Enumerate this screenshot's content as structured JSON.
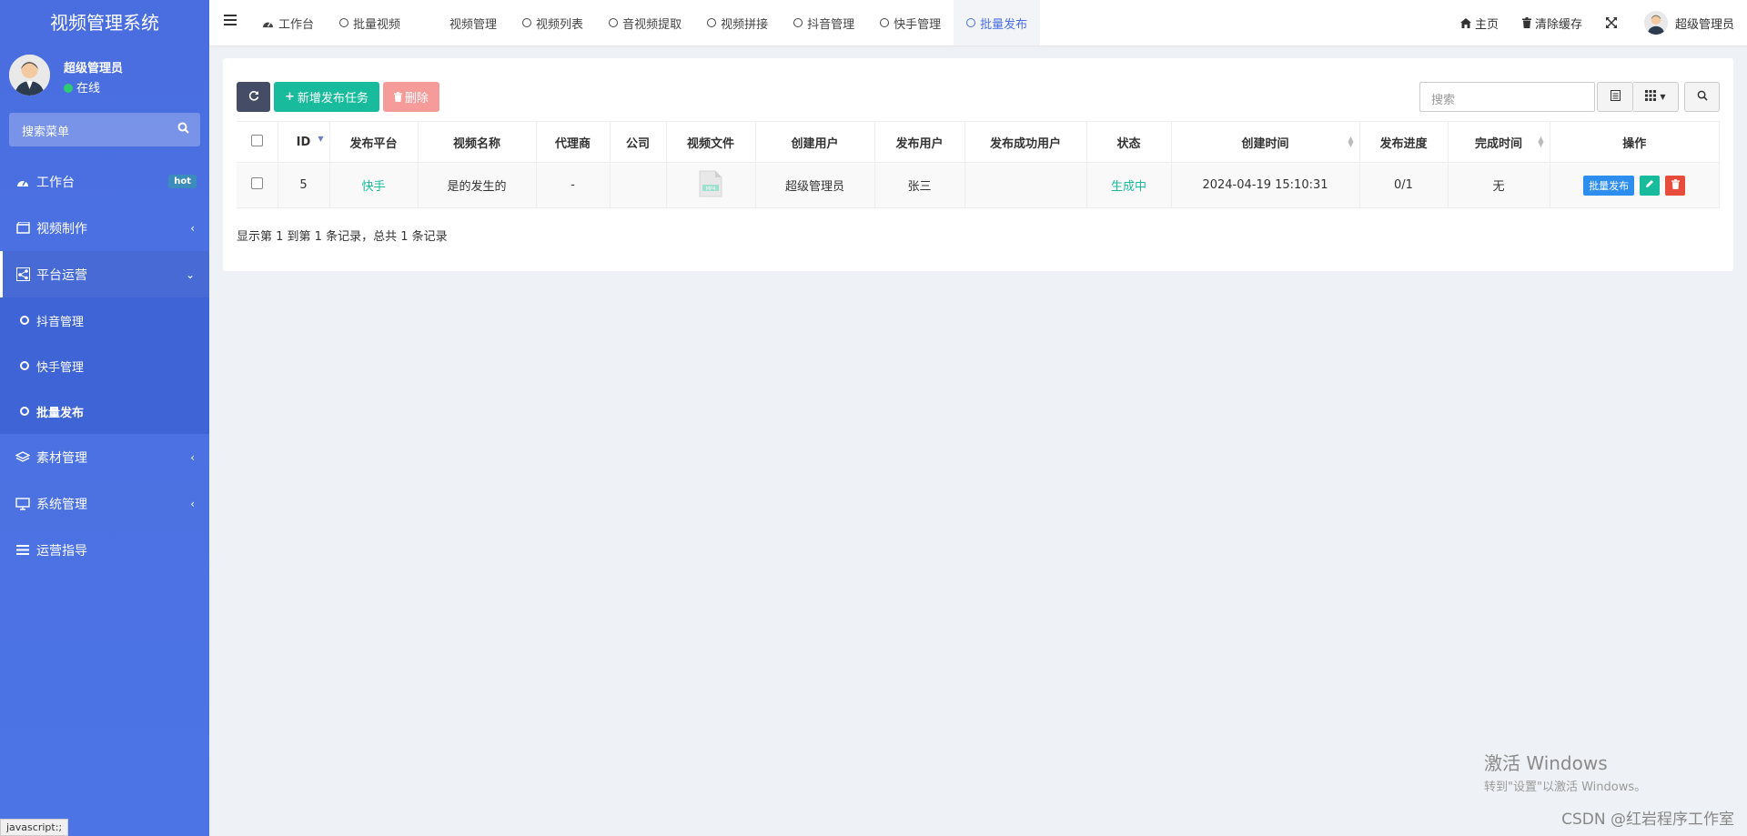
{
  "app": {
    "title": "视频管理系统"
  },
  "user": {
    "name": "超级管理员",
    "status": "在线"
  },
  "sidebar": {
    "search_placeholder": "搜索菜单",
    "items": [
      {
        "label": "工作台",
        "badge": "hot",
        "icon": "dashboard-icon"
      },
      {
        "label": "视频制作",
        "icon": "film-icon"
      },
      {
        "label": "平台运营",
        "icon": "share-icon"
      },
      {
        "label": "素材管理",
        "icon": "layers-icon"
      },
      {
        "label": "系统管理",
        "icon": "monitor-icon"
      },
      {
        "label": "运营指导",
        "icon": "list-icon"
      }
    ],
    "subitems": [
      {
        "label": "抖音管理"
      },
      {
        "label": "快手管理"
      },
      {
        "label": "批量发布"
      }
    ]
  },
  "topnav": {
    "tabs": [
      {
        "label": "工作台"
      },
      {
        "label": "批量视频"
      },
      {
        "label": "视频管理"
      },
      {
        "label": "视频列表"
      },
      {
        "label": "音视频提取"
      },
      {
        "label": "视频拼接"
      },
      {
        "label": "抖音管理"
      },
      {
        "label": "快手管理"
      },
      {
        "label": "批量发布"
      }
    ],
    "home": "主页",
    "clear_cache": "清除缓存",
    "user": "超级管理员"
  },
  "toolbar": {
    "add_label": "新增发布任务",
    "delete_label": "删除",
    "search_placeholder": "搜索"
  },
  "table": {
    "columns": [
      "ID",
      "发布平台",
      "视频名称",
      "代理商",
      "公司",
      "视频文件",
      "创建用户",
      "发布用户",
      "发布成功用户",
      "状态",
      "创建时间",
      "发布进度",
      "完成时间",
      "操作"
    ],
    "rows": [
      {
        "id": "5",
        "platform": "快手",
        "video_name": "是的发生的",
        "agent": "-",
        "company": "",
        "file_type": "MP4",
        "creator": "超级管理员",
        "publisher": "张三",
        "success_users": "",
        "status": "生成中",
        "created_at": "2024-04-19 15:10:31",
        "progress": "0/1",
        "finished_at": "无",
        "op_publish": "批量发布"
      }
    ],
    "summary": "显示第 1 到第 1 条记录，总共 1 条记录"
  },
  "overlay": {
    "status_url": "javascript:;",
    "activate_title": "激活 Windows",
    "activate_sub": "转到\"设置\"以激活 Windows。",
    "csdn": "CSDN @红岩程序工作室"
  },
  "colors": {
    "sidebar": "#4a6ee0",
    "accent": "#18bc9c",
    "danger": "#e74c3c",
    "primary": "#2e8ef0"
  }
}
